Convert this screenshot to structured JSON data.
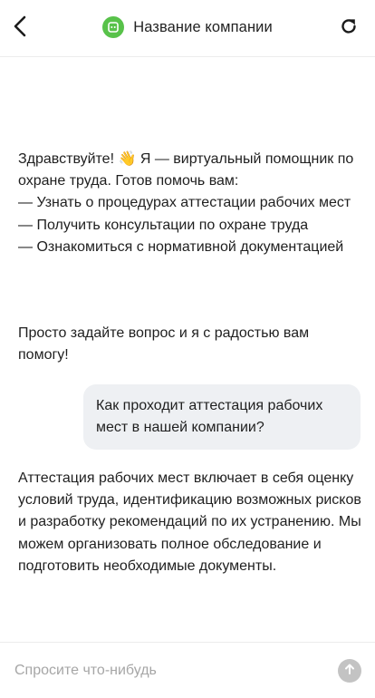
{
  "header": {
    "title": "Название компании"
  },
  "icons": {
    "back": "chevron-left-icon",
    "brand": "company-logo-icon",
    "refresh": "refresh-icon",
    "send": "arrow-up-icon"
  },
  "colors": {
    "brand_green": "#58c24a",
    "bubble_bg": "#eef0f3",
    "send_disabled": "#c3c3c3"
  },
  "chat": {
    "greeting": {
      "lines": [
        "Здравствуйте! 👋 Я — виртуальный помощник по охране труда. Готов помочь вам:",
        "— Узнать о процедурах аттестации рабочих мест",
        "— Получить консультации по охране труда",
        "— Ознакомиться с нормативной документацией"
      ]
    },
    "cta": "Просто задайте вопрос и я с радостью вам помогу!",
    "user_question": "Как проходит аттестация рабочих мест в нашей компании?",
    "answer": "Аттестация рабочих мест включает в себя оценку условий труда, идентификацию возможных рисков и разработку рекомендаций по их устранению. Мы можем организовать полное обследование и подготовить необходимые документы."
  },
  "input": {
    "value": "",
    "placeholder": "Спросите что-нибудь"
  }
}
